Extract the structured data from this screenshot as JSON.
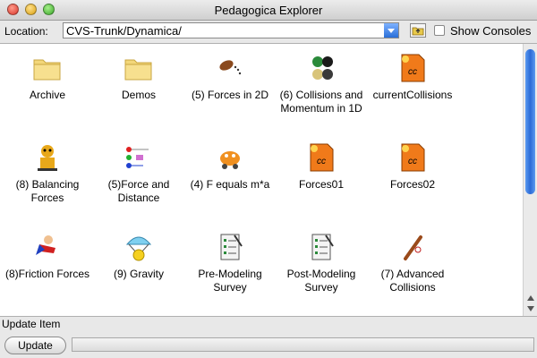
{
  "window": {
    "title": "Pedagogica Explorer"
  },
  "location": {
    "label": "Location:",
    "value": "CVS-Trunk/Dynamica/"
  },
  "show_consoles": {
    "label": "Show Consoles",
    "checked": false
  },
  "items": [
    {
      "label": "Archive",
      "icon": "folder-icon"
    },
    {
      "label": "Demos",
      "icon": "folder-icon"
    },
    {
      "label": "(5) Forces in 2D",
      "icon": "football-trajectory-icon"
    },
    {
      "label": "(6) Collisions and Momentum in 1D",
      "icon": "billiard-balls-icon"
    },
    {
      "label": "currentCollisions",
      "icon": "cc-document-icon"
    },
    {
      "label": "(8) Balancing Forces",
      "icon": "balancing-character-icon"
    },
    {
      "label": "(5)Force and Distance",
      "icon": "force-distance-diagram-icon"
    },
    {
      "label": "(4) F equals m*a",
      "icon": "cart-creature-icon"
    },
    {
      "label": "Forces01",
      "icon": "cc-document-icon"
    },
    {
      "label": "Forces02",
      "icon": "cc-document-icon"
    },
    {
      "label": "(8)Friction Forces",
      "icon": "superhero-icon"
    },
    {
      "label": "(9) Gravity",
      "icon": "parachute-icon"
    },
    {
      "label": "Pre-Modeling Survey",
      "icon": "survey-clipboard-icon"
    },
    {
      "label": "Post-Modeling Survey",
      "icon": "survey-clipboard-icon"
    },
    {
      "label": "(7) Advanced Collisions",
      "icon": "bat-ball-icon"
    }
  ],
  "status": {
    "text": "Update Item"
  },
  "update_button": {
    "label": "Update"
  },
  "progress": {
    "value": 0
  },
  "colors": {
    "accent": "#2b6ad6",
    "cc_orange": "#f07a1a"
  }
}
